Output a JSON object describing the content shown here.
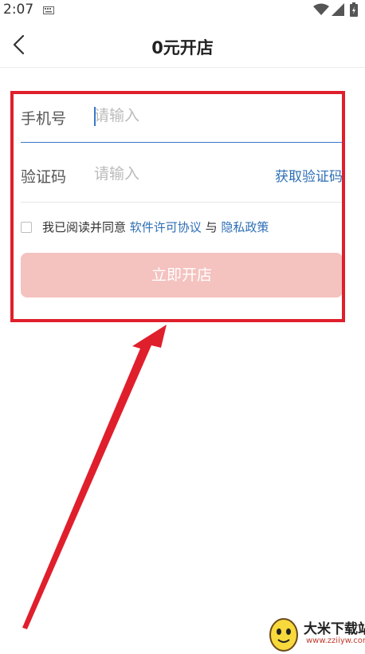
{
  "status_bar": {
    "time": "2:07"
  },
  "header": {
    "title": "0元开店"
  },
  "form": {
    "phone_label": "手机号",
    "phone_placeholder": "请输入",
    "code_label": "验证码",
    "code_placeholder": "请输入",
    "get_code_label": "获取验证码",
    "agree_prefix": "我已阅读并同意",
    "license_link": "软件许可协议",
    "agree_and": "与",
    "privacy_link": "隐私政策",
    "submit_label": "立即开店"
  },
  "colors": {
    "accent_blue": "#2f6fb5",
    "submit_disabled": "#f4c2bf",
    "annotation_red": "#e01f2c"
  },
  "watermark": {
    "brand": "大米下载站",
    "url": "www.zziiyw.com"
  }
}
